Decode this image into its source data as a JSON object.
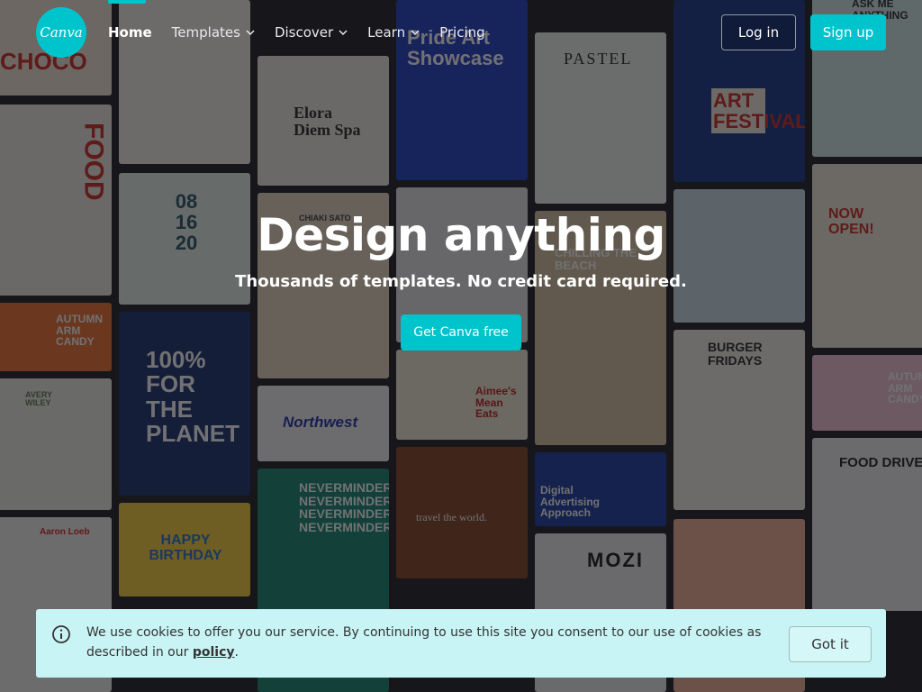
{
  "nav": {
    "logo_text": "Canva",
    "links": [
      {
        "label": "Home",
        "dropdown": false,
        "active": true
      },
      {
        "label": "Templates",
        "dropdown": true,
        "active": false
      },
      {
        "label": "Discover",
        "dropdown": true,
        "active": false
      },
      {
        "label": "Learn",
        "dropdown": true,
        "active": false
      },
      {
        "label": "Pricing",
        "dropdown": false,
        "active": false
      }
    ],
    "login_label": "Log in",
    "signup_label": "Sign up"
  },
  "hero": {
    "title": "Design anything",
    "subtitle": "Thousands of templates. No credit card required.",
    "cta_label": "Get Canva free"
  },
  "cookie": {
    "text_before": "We use cookies to offer you our service. By continuing to use this site you consent to our use of cookies as described in our ",
    "link_label": "policy",
    "text_after": ".",
    "button_label": "Got it",
    "icon": "info-icon"
  },
  "collage": {
    "tiles": [
      {
        "name": "tile-choco",
        "bg": "#f3e6d8",
        "text": "CHOCO",
        "color": "#d2342b"
      },
      {
        "name": "tile-food",
        "bg": "#f0ece4",
        "text": "FOOD",
        "color": "#d2342b"
      },
      {
        "name": "tile-autumn-arm-candy",
        "bg": "#f07838",
        "text": "AUTUMN ARM CANDY",
        "color": "#ffffff"
      },
      {
        "name": "tile-avery-wiley",
        "bg": "#eef0e4",
        "text": "AVERY WILEY",
        "color": "#6a7a5a"
      },
      {
        "name": "tile-aaron-loeb",
        "bg": "#f6f4ee",
        "text": "Aaron Loeb",
        "color": "#d2342b"
      },
      {
        "name": "tile-menu",
        "bg": "#f4f1ea",
        "text": "",
        "color": "#555555"
      },
      {
        "name": "tile-08-16-20",
        "bg": "#e6f1ea",
        "text": "08 16 20",
        "color": "#335b6b"
      },
      {
        "name": "tile-100-for-the-planet",
        "bg": "#243a73",
        "text": "100% FOR THE PLANET",
        "color": "#ffffff"
      },
      {
        "name": "tile-happy-birthday",
        "bg": "#f7d243",
        "text": "HAPPY BIRTHDAY",
        "color": "#2e7bd1"
      },
      {
        "name": "tile-elora-diem-spa",
        "bg": "#f1ece2",
        "text": "Elora Diem Spa",
        "color": "#333333"
      },
      {
        "name": "tile-chiaki-sato",
        "bg": "#e9d8c2",
        "text": "CHIAKI SATO",
        "color": "#444444"
      },
      {
        "name": "tile-northwest",
        "bg": "#f4f4f4",
        "text": "Northwest",
        "color": "#2b3aa8"
      },
      {
        "name": "tile-neverminder",
        "bg": "#1f8a76",
        "text": "NEVERMINDER NEVERMINDER NEVERMINDER NEVERMINDER",
        "color": "#ffffff"
      },
      {
        "name": "tile-pride-art-showcase",
        "bg": "#2a47c7",
        "text": "Pride Art Showcase",
        "color": "#ffffff"
      },
      {
        "name": "tile-pattern",
        "bg": "#e8e8e8",
        "text": "",
        "color": "#333333"
      },
      {
        "name": "tile-aimees-mean-eats",
        "bg": "#f3e9d6",
        "text": "Aimee's Mean Eats",
        "color": "#c02a2a"
      },
      {
        "name": "tile-travel-the-world",
        "bg": "#8a4a2e",
        "text": "travel the world.",
        "color": "#ffffff"
      },
      {
        "name": "tile-pastel",
        "bg": "#f0f2ee",
        "text": "PASTEL",
        "color": "#333333"
      },
      {
        "name": "tile-chilling-the-beach",
        "bg": "#d9c7a5",
        "text": "CHILLING THE BEACH",
        "color": "#ffffff"
      },
      {
        "name": "tile-digital-advertising",
        "bg": "#2444a8",
        "text": "Digital Advertising Approach",
        "color": "#ffffff"
      },
      {
        "name": "tile-mozi",
        "bg": "#efefef",
        "text": "MOZI",
        "color": "#222222"
      },
      {
        "name": "tile-art-festival",
        "bg": "#1f3e8c",
        "text": "ART FESTIVAL",
        "color": "#d2342b"
      },
      {
        "name": "tile-beach-photo",
        "bg": "#cfe0e6",
        "text": "",
        "color": "#333333"
      },
      {
        "name": "tile-burger-fridays",
        "bg": "#f2f0ea",
        "text": "BURGER FRIDAYS",
        "color": "#333333"
      },
      {
        "name": "tile-pink-portrait",
        "bg": "#f3b49a",
        "text": "",
        "color": "#ffffff"
      },
      {
        "name": "tile-ask-me-anything",
        "bg": "#d6ecea",
        "text": "ASK ME ANYTHING",
        "color": "#333333"
      },
      {
        "name": "tile-now-open",
        "bg": "#f4ecde",
        "text": "NOW OPEN!",
        "color": "#d2342b"
      },
      {
        "name": "tile-autumn-arm-candy-2",
        "bg": "#f2c6d6",
        "text": "AUTUMN ARM CANDY",
        "color": "#ffffff"
      },
      {
        "name": "tile-food-drive",
        "bg": "#f1f1f1",
        "text": "FOOD DRIVE",
        "color": "#2a2a2a"
      }
    ]
  }
}
